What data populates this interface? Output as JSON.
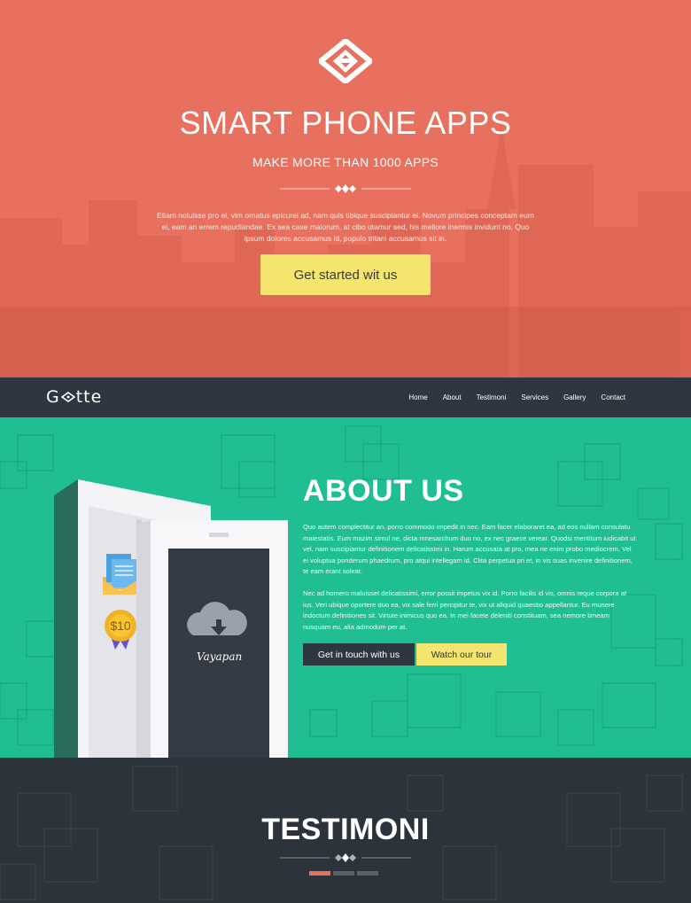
{
  "hero": {
    "title": "SMART PHONE APPS",
    "subtitle": "MAKE MORE THAN 1000 APPS",
    "text": "Etiam noluisse pro ei, vim ornatus epicurei ad, nam quis tibique suscipiantur ei. Novum principes conceptam eum ei, eam an errem repudiandae. Ex sea case malorum, at cibo utamur sed, his meliore inermis invidunt no. Quo ipsum dolores accusamus id, populo tritani accusamus sit in.",
    "cta_label": "Get started wit us"
  },
  "nav": {
    "brand": "Gotte",
    "links": [
      "Home",
      "About",
      "Testimoni",
      "Services",
      "Gallery",
      "Contact"
    ]
  },
  "about": {
    "title": "ABOUT US",
    "paragraph1": "Quo autem complectitur an, porro commodo impedit in nec. Eam facer elaboraret ea, ad eos nullam consulatu maiestatis. Eum mazim simul ne, dicta mnesarchum duo no, ex nec graece verear. Quodsi mentitum iudicabit ut vel, nam suscipiantur definitionem delicatissimi in. Harum accusata at pro, mea ne enim probo mediocrem. Vel ei voluptua ponderum phaedrum, pro atqui intellegam id. Clita perpetua pri et, in vis suas invenire definitionem, te eam erant soleat.",
    "paragraph2": "Nec ad homero maluisset delicatissimi, error possit impetus vix id. Porro facilis id vis, omnis reque corpora at ius. Veri ubique oportere duo ea, vix sale ferri percipitur te, vix ut aliquid quaestio appellantur. Eu munere indoctum definitiones sit. Virtute inimicus quo ea. In mei facete deleniti constituam, sea nemore timeam nusquam eu, alia admodum per at.",
    "btn_contact": "Get in touch with us",
    "btn_tour": "Watch our tour",
    "badge_price": "$10",
    "phone_app_name": "Vayapan"
  },
  "testimoni": {
    "title": "TESTIMONI"
  },
  "colors": {
    "hero_bg": "#e8705e",
    "nav_bg": "#2f363f",
    "about_bg": "#1fbf93",
    "accent_yellow": "#f3e56e"
  }
}
